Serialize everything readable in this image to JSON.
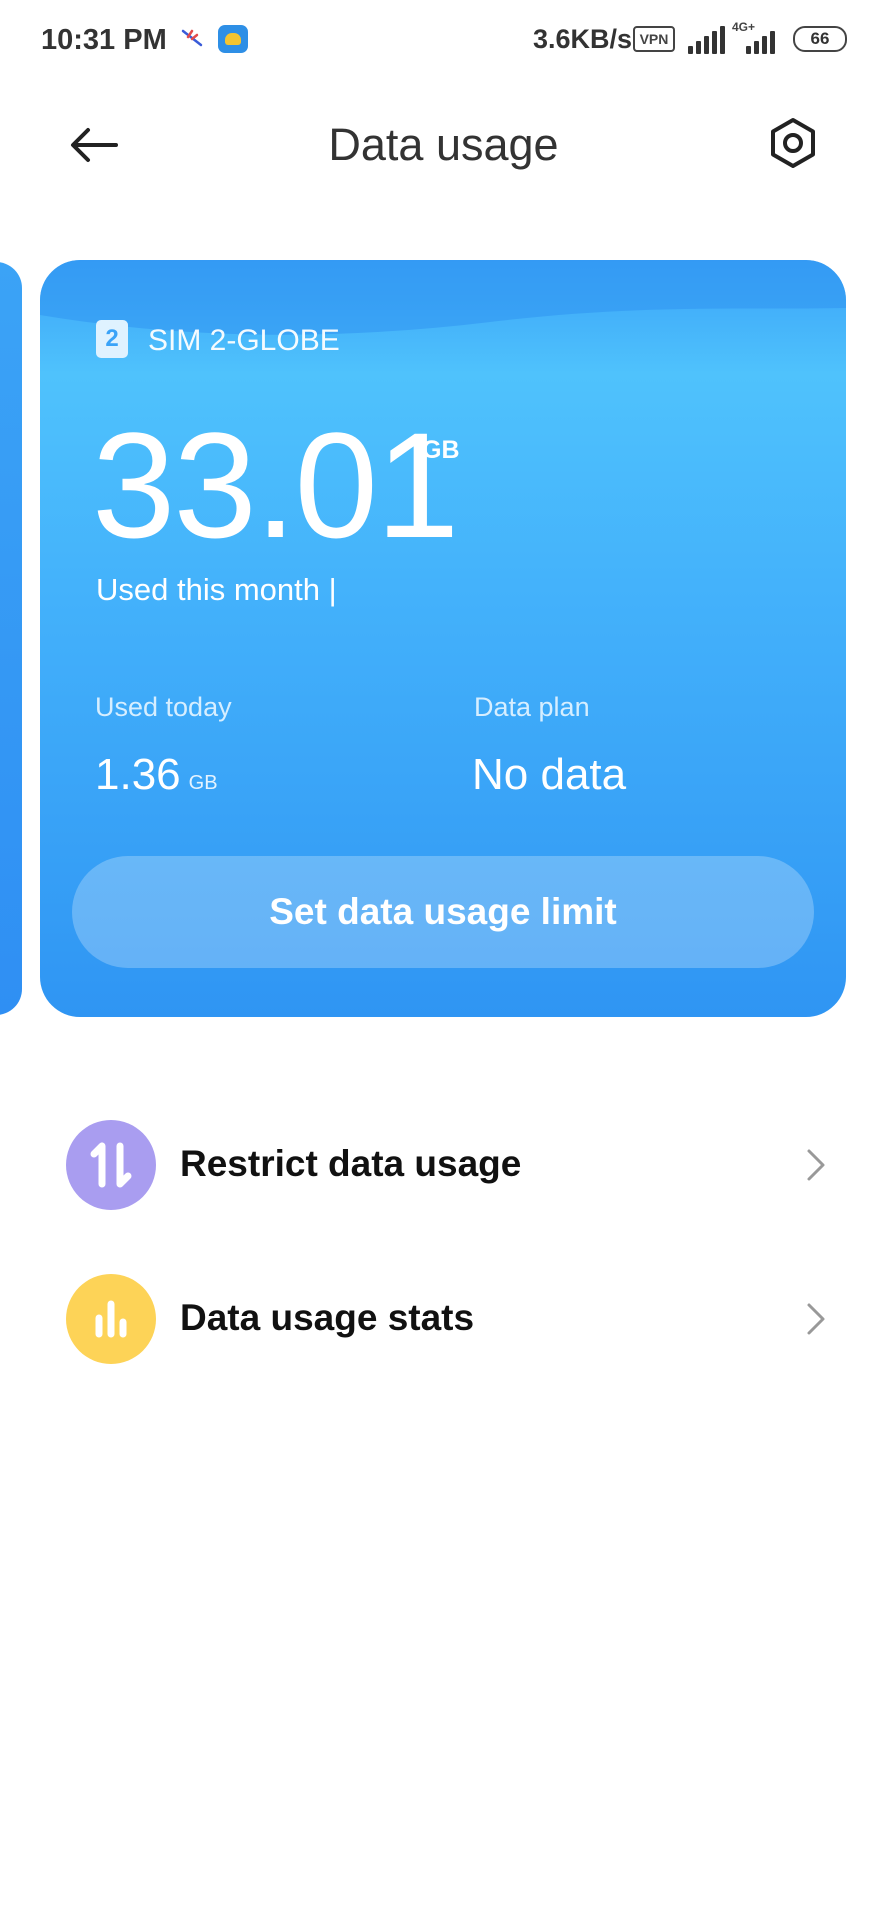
{
  "status_bar": {
    "time": "10:31 PM",
    "network_speed": "3.6KB/s",
    "vpn_label": "VPN",
    "network_type": "4G+",
    "battery": "66"
  },
  "header": {
    "title": "Data usage",
    "back_icon": "arrow-left-icon",
    "settings_icon": "settings-gear-icon"
  },
  "card": {
    "sim_number": "2",
    "sim_name": "SIM 2-GLOBE",
    "used_month_value": "33.01",
    "used_month_unit": "GB",
    "used_month_label": "Used this month |",
    "used_today_label": "Used today",
    "used_today_value": "1.36",
    "used_today_unit": "GB",
    "data_plan_label": "Data plan",
    "data_plan_value": "No data",
    "limit_button": "Set data usage limit"
  },
  "menu": [
    {
      "label": "Restrict data usage",
      "icon": "restrict-arrows-icon",
      "color": "#a99df0"
    },
    {
      "label": "Data usage stats",
      "icon": "bar-chart-icon",
      "color": "#fdd357"
    }
  ],
  "colors": {
    "card_top": "#4fc2fc",
    "card_bottom": "#2f95f3",
    "restrict_icon_bg": "#a99df0",
    "stats_icon_bg": "#fdd357"
  }
}
